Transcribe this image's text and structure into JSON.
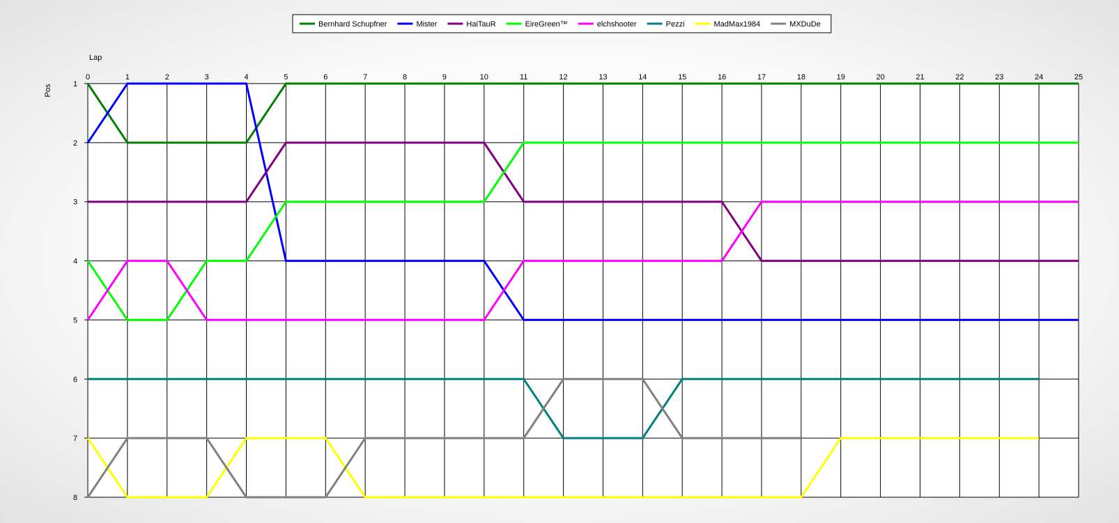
{
  "chart_data": {
    "type": "line",
    "xlabel": "Lap",
    "ylabel": "Pos",
    "xlim": [
      0,
      25
    ],
    "ylim": [
      1,
      8
    ],
    "y_inverted": true,
    "grid": true,
    "legend_position": "top-center",
    "x_ticks": [
      0,
      1,
      2,
      3,
      4,
      5,
      6,
      7,
      8,
      9,
      10,
      11,
      12,
      13,
      14,
      15,
      16,
      17,
      18,
      19,
      20,
      21,
      22,
      23,
      24,
      25
    ],
    "y_ticks": [
      1,
      2,
      3,
      4,
      5,
      6,
      7,
      8
    ],
    "x": [
      0,
      1,
      2,
      3,
      4,
      5,
      6,
      7,
      8,
      9,
      10,
      11,
      12,
      13,
      14,
      15,
      16,
      17,
      18,
      19,
      20,
      21,
      22,
      23,
      24,
      25
    ],
    "series": [
      {
        "name": "Bernhard Schupfner",
        "color": "#008000",
        "values": [
          1,
          2,
          2,
          2,
          2,
          1,
          1,
          1,
          1,
          1,
          1,
          1,
          1,
          1,
          1,
          1,
          1,
          1,
          1,
          1,
          1,
          1,
          1,
          1,
          1,
          1
        ]
      },
      {
        "name": "Mister",
        "color": "#0000ff",
        "values": [
          2,
          1,
          1,
          1,
          1,
          4,
          4,
          4,
          4,
          4,
          4,
          5,
          5,
          5,
          5,
          5,
          5,
          5,
          5,
          5,
          5,
          5,
          5,
          5,
          5,
          5
        ]
      },
      {
        "name": "HaiTauR",
        "color": "#800080",
        "values": [
          3,
          3,
          3,
          3,
          3,
          2,
          2,
          2,
          2,
          2,
          2,
          3,
          3,
          3,
          3,
          3,
          3,
          4,
          4,
          4,
          4,
          4,
          4,
          4,
          4,
          4
        ]
      },
      {
        "name": "EireGreen™",
        "color": "#00ff00",
        "values": [
          4,
          5,
          5,
          4,
          4,
          3,
          3,
          3,
          3,
          3,
          3,
          2,
          2,
          2,
          2,
          2,
          2,
          2,
          2,
          2,
          2,
          2,
          2,
          2,
          2,
          2
        ]
      },
      {
        "name": "elchshooter",
        "color": "#ff00ff",
        "values": [
          5,
          4,
          4,
          5,
          5,
          5,
          5,
          5,
          5,
          5,
          5,
          4,
          4,
          4,
          4,
          4,
          4,
          3,
          3,
          3,
          3,
          3,
          3,
          3,
          3,
          3
        ]
      },
      {
        "name": "Pezzi",
        "color": "#008080",
        "values": [
          6,
          6,
          6,
          6,
          6,
          6,
          6,
          6,
          6,
          6,
          6,
          6,
          7,
          7,
          7,
          6,
          6,
          6,
          6,
          6,
          6,
          6,
          6,
          6,
          6,
          null
        ]
      },
      {
        "name": "MadMax1984",
        "color": "#ffff00",
        "values": [
          7,
          8,
          8,
          8,
          7,
          7,
          7,
          8,
          8,
          8,
          8,
          8,
          8,
          8,
          8,
          8,
          8,
          8,
          8,
          7,
          7,
          7,
          7,
          7,
          7,
          null
        ]
      },
      {
        "name": "MXDuDe",
        "color": "#808080",
        "values": [
          8,
          7,
          7,
          7,
          8,
          8,
          8,
          7,
          7,
          7,
          7,
          7,
          6,
          6,
          6,
          7,
          7,
          7,
          7,
          null,
          null,
          null,
          null,
          null,
          null,
          null
        ]
      }
    ]
  }
}
